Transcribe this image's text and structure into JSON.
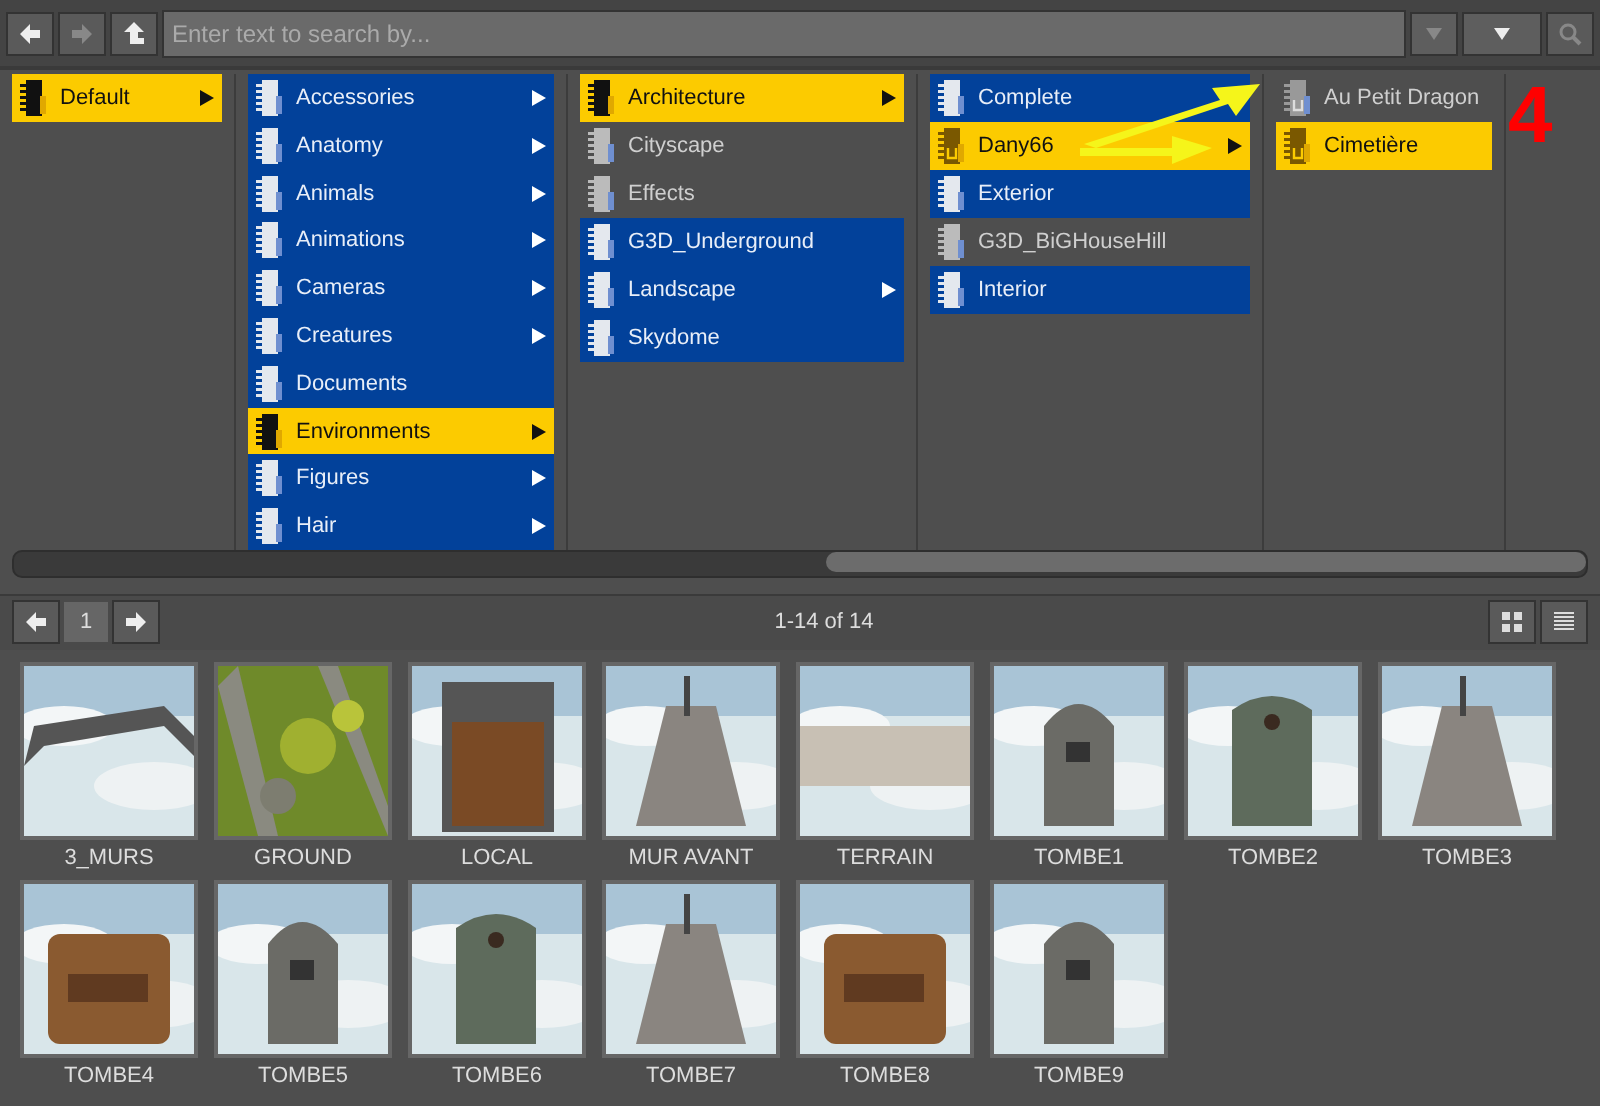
{
  "toolbar": {
    "search": {
      "placeholder": "Enter text to search by..."
    }
  },
  "columns": [
    {
      "items": [
        {
          "label": "Default",
          "selected": true,
          "has_content": true,
          "kind": "folder",
          "has_children": true
        }
      ]
    },
    {
      "items": [
        {
          "label": "Accessories",
          "selected": false,
          "has_content": true,
          "kind": "folder",
          "has_children": true
        },
        {
          "label": "Anatomy",
          "selected": false,
          "has_content": true,
          "kind": "folder",
          "has_children": true
        },
        {
          "label": "Animals",
          "selected": false,
          "has_content": true,
          "kind": "folder",
          "has_children": true
        },
        {
          "label": "Animations",
          "selected": false,
          "has_content": true,
          "kind": "folder",
          "has_children": true
        },
        {
          "label": "Cameras",
          "selected": false,
          "has_content": true,
          "kind": "folder",
          "has_children": true
        },
        {
          "label": "Creatures",
          "selected": false,
          "has_content": true,
          "kind": "folder",
          "has_children": true
        },
        {
          "label": "Documents",
          "selected": false,
          "has_content": true,
          "kind": "folder",
          "has_children": false
        },
        {
          "label": "Environments",
          "selected": true,
          "has_content": true,
          "kind": "folder",
          "has_children": true
        },
        {
          "label": "Figures",
          "selected": false,
          "has_content": true,
          "kind": "folder",
          "has_children": true
        },
        {
          "label": "Hair",
          "selected": false,
          "has_content": true,
          "kind": "folder",
          "has_children": true
        }
      ]
    },
    {
      "items": [
        {
          "label": "Architecture",
          "selected": true,
          "has_content": true,
          "kind": "folder",
          "has_children": true
        },
        {
          "label": "Cityscape",
          "selected": false,
          "has_content": false,
          "kind": "folder",
          "has_children": false
        },
        {
          "label": "Effects",
          "selected": false,
          "has_content": false,
          "kind": "folder",
          "has_children": false
        },
        {
          "label": "G3D_Underground",
          "selected": false,
          "has_content": true,
          "kind": "folder",
          "has_children": false
        },
        {
          "label": "Landscape",
          "selected": false,
          "has_content": true,
          "kind": "folder",
          "has_children": true
        },
        {
          "label": "Skydome",
          "selected": false,
          "has_content": true,
          "kind": "folder",
          "has_children": false
        }
      ]
    },
    {
      "items": [
        {
          "label": "Complete",
          "selected": false,
          "has_content": true,
          "kind": "folder",
          "has_children": false
        },
        {
          "label": "Dany66",
          "selected": true,
          "has_content": true,
          "kind": "user",
          "has_children": true
        },
        {
          "label": "Exterior",
          "selected": false,
          "has_content": true,
          "kind": "folder",
          "has_children": false
        },
        {
          "label": "G3D_BiGHouseHill",
          "selected": false,
          "has_content": false,
          "kind": "folder",
          "has_children": false
        },
        {
          "label": "Interior",
          "selected": false,
          "has_content": true,
          "kind": "folder",
          "has_children": false
        }
      ]
    },
    {
      "items": [
        {
          "label": "Au Petit Dragon",
          "selected": false,
          "has_content": false,
          "kind": "user",
          "has_children": false
        },
        {
          "label": "Cimetière",
          "selected": true,
          "has_content": true,
          "kind": "user",
          "has_children": false
        }
      ]
    }
  ],
  "annotation": {
    "label": "4"
  },
  "pager": {
    "page": "1",
    "range": "1-14 of 14"
  },
  "thumbnails": [
    {
      "label": "3_MURS"
    },
    {
      "label": "GROUND"
    },
    {
      "label": "LOCAL"
    },
    {
      "label": "MUR AVANT"
    },
    {
      "label": "TERRAIN"
    },
    {
      "label": "TOMBE1"
    },
    {
      "label": "TOMBE2"
    },
    {
      "label": "TOMBE3"
    },
    {
      "label": "TOMBE4"
    },
    {
      "label": "TOMBE5"
    },
    {
      "label": "TOMBE6"
    },
    {
      "label": "TOMBE7"
    },
    {
      "label": "TOMBE8"
    },
    {
      "label": "TOMBE9"
    }
  ]
}
